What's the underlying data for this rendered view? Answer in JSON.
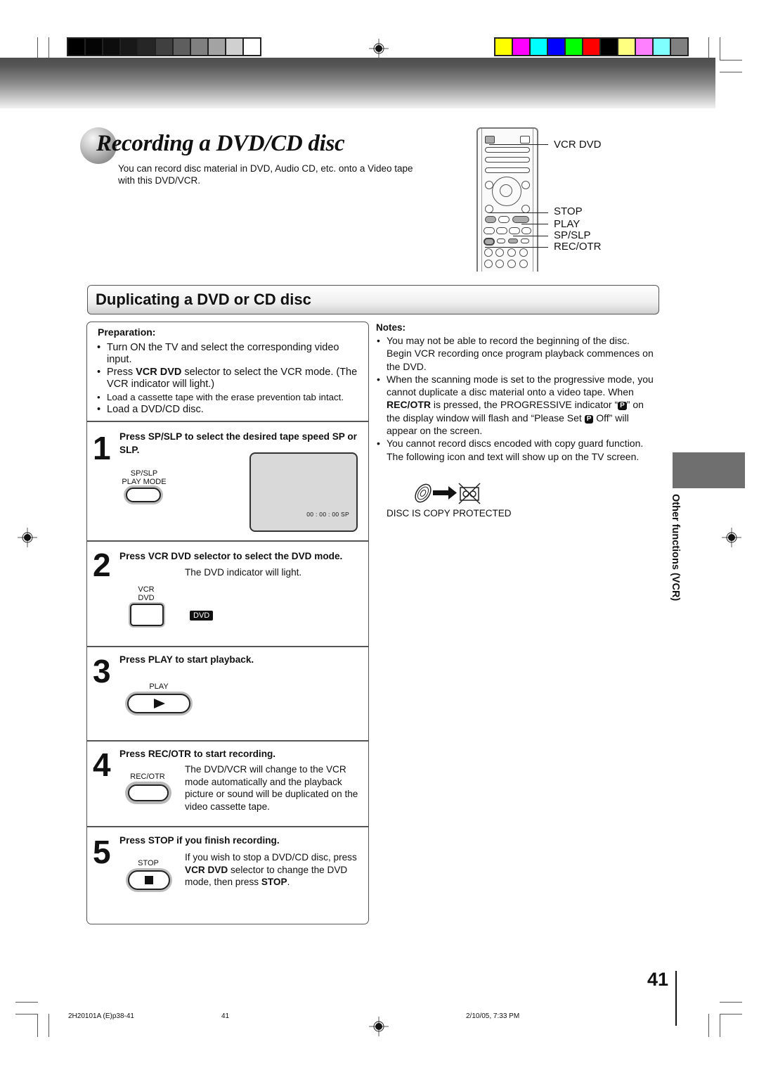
{
  "color_bars": {
    "grayscale": [
      "#000000",
      "#050505",
      "#0d0d0d",
      "#181818",
      "#262626",
      "#404040",
      "#5e5e5e",
      "#808080",
      "#a3a3a3",
      "#d0d0d0",
      "#ffffff"
    ],
    "colors": [
      "#ffff00",
      "#ff00ff",
      "#00ffff",
      "#0000ff",
      "#00ff00",
      "#ff0000",
      "#000000",
      "#ffff80",
      "#ff80ff",
      "#80ffff",
      "#808080"
    ]
  },
  "header": {
    "title": "Recording a DVD/CD disc",
    "intro": "You can record disc material in DVD, Audio CD, etc. onto a Video tape with this DVD/VCR."
  },
  "remote": {
    "callouts": [
      "VCR DVD",
      "STOP",
      "PLAY",
      "SP/SLP",
      "REC/OTR"
    ]
  },
  "section": {
    "title": "Duplicating a DVD or CD disc"
  },
  "preparation": {
    "title": "Preparation:",
    "items": [
      {
        "text": "Turn ON the TV and select the corresponding video input."
      },
      {
        "pre": "Press ",
        "bold": "VCR DVD",
        "post": " selector to select the VCR mode. (The VCR indicator will light.)"
      },
      {
        "text": "Load a cassette tape with the erase prevention tab intact."
      },
      {
        "text": "Load a DVD/CD disc."
      }
    ]
  },
  "steps": [
    {
      "number": "1",
      "heading": "Press SP/SLP to select the desired tape speed SP or SLP.",
      "button_caption_1": "SP/SLP",
      "button_caption_2": "PLAY MODE",
      "tv_readout": "00 : 00 : 00  SP"
    },
    {
      "number": "2",
      "heading": "Press VCR DVD selector to select the DVD mode.",
      "text": "The DVD indicator will light.",
      "button_caption_1": "VCR",
      "button_caption_2": "DVD",
      "indicator": "DVD"
    },
    {
      "number": "3",
      "heading": "Press PLAY to start playback.",
      "button_caption": "PLAY"
    },
    {
      "number": "4",
      "heading": "Press REC/OTR to start recording.",
      "button_caption": "REC/OTR",
      "text": "The DVD/VCR will change to the VCR mode automatically and the playback picture or sound will be duplicated on the video cassette tape."
    },
    {
      "number": "5",
      "heading": "Press STOP if you finish recording.",
      "button_caption": "STOP",
      "text_pre": "If you wish to stop a DVD/CD disc, press ",
      "text_bold1": "VCR DVD",
      "text_mid": " selector to change the DVD mode, then press ",
      "text_bold2": "STOP",
      "text_post": "."
    }
  ],
  "notes": {
    "title": "Notes:",
    "note1": "You may not be able to record the beginning of the disc. Begin VCR recording once program playback commences on the DVD.",
    "note2_a": "When the scanning mode is set to the progressive mode, you cannot duplicate a disc material onto a video tape. When ",
    "note2_bold": "REC/OTR",
    "note2_b": " is pressed, the PROGRESSIVE indicator “",
    "p_icon": "P",
    "note2_c": "” on the display window will flash and “Please Set ",
    "note2_d": " Off” will appear on the screen.",
    "note3": "You cannot record discs encoded with copy guard function. The following icon and text will show up on the TV screen.",
    "copy_protected": "DISC IS COPY PROTECTED"
  },
  "side_tab": {
    "label": "Other functions (VCR)",
    "color": "#6f6f6f"
  },
  "page_number": "41",
  "footer": {
    "file": "2H20101A (E)p38-41",
    "page": "41",
    "date": "2/10/05, 7:33 PM"
  }
}
